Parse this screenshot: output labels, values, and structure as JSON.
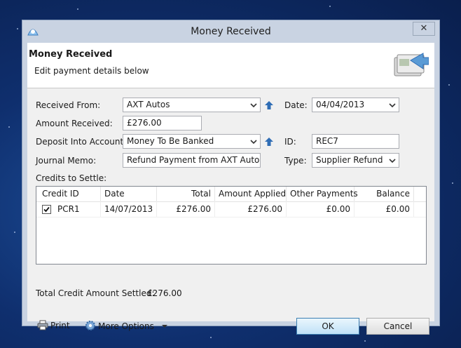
{
  "window": {
    "title": "Money Received",
    "close_glyph": "✕"
  },
  "header": {
    "title": "Money Received",
    "subtitle": "Edit payment details below"
  },
  "form": {
    "received_from_label": "Received From:",
    "received_from_value": "AXT Autos",
    "date_label": "Date:",
    "date_value": "04/04/2013",
    "amount_received_label": "Amount Received:",
    "amount_received_value": "£276.00",
    "deposit_into_label": "Deposit Into Account:",
    "deposit_into_value": "Money To Be Banked",
    "id_label": "ID:",
    "id_value": "REC7",
    "journal_memo_label": "Journal Memo:",
    "journal_memo_value": "Refund Payment from AXT Autos",
    "type_label": "Type:",
    "type_value": "Supplier Refund",
    "credits_label": "Credits to Settle:"
  },
  "grid": {
    "columns": [
      "Credit ID",
      "Date",
      "Total",
      "Amount Applied",
      "Other Payments",
      "Balance"
    ],
    "rows": [
      {
        "checked": true,
        "credit_id": "PCR1",
        "date": "14/07/2013",
        "total": "£276.00",
        "amount_applied": "£276.00",
        "other_payments": "£0.00",
        "balance": "£0.00"
      }
    ]
  },
  "total_settled": {
    "label": "Total Credit Amount Settled:",
    "value": "£276.00"
  },
  "footer": {
    "print_label": "Print",
    "more_options_label": "More Options",
    "ok_label": "OK",
    "cancel_label": "Cancel"
  },
  "icons": {
    "app": "app-icon",
    "header": "payment-icon",
    "combo": "chevron-down-icon",
    "lookup": "up-arrow-icon",
    "print": "printer-icon",
    "options": "gear-icon",
    "check": "checkmark-icon"
  },
  "colors": {
    "ok_border": "#3c7fb1",
    "lookup_arrow": "#2f6db5"
  }
}
